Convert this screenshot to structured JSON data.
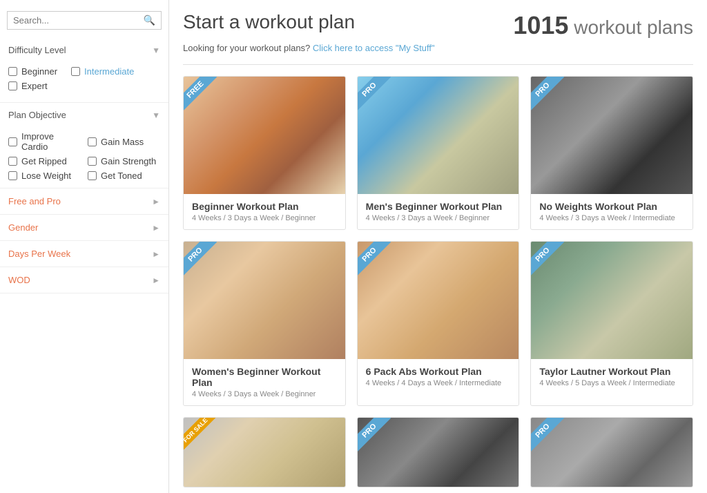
{
  "sidebar": {
    "search_placeholder": "Search...",
    "filters": {
      "difficulty": {
        "label": "Difficulty Level",
        "options": [
          {
            "label": "Beginner",
            "checked": false
          },
          {
            "label": "Intermediate",
            "checked": false,
            "highlighted": true
          },
          {
            "label": "Expert",
            "checked": false
          }
        ]
      },
      "plan_objective": {
        "label": "Plan Objective",
        "options": [
          {
            "label": "Improve Cardio",
            "checked": false
          },
          {
            "label": "Gain Mass",
            "checked": false
          },
          {
            "label": "Get Ripped",
            "checked": false
          },
          {
            "label": "Gain Strength",
            "checked": false
          },
          {
            "label": "Lose Weight",
            "checked": false
          },
          {
            "label": "Get Toned",
            "checked": false
          }
        ]
      }
    },
    "expandable_filters": [
      {
        "label": "Free and Pro"
      },
      {
        "label": "Gender"
      },
      {
        "label": "Days Per Week"
      },
      {
        "label": "WOD"
      }
    ]
  },
  "main": {
    "title": "Start a workout plan",
    "plan_count_number": "1015",
    "plan_count_label": "workout plans",
    "sub_header_text": "Looking for your workout plans?",
    "sub_header_link": "Click here to access \"My Stuff\"",
    "cards": [
      {
        "id": 1,
        "title": "Beginner Workout Plan",
        "meta": "4 Weeks / 3 Days a Week / Beginner",
        "badge": "FREE",
        "badge_type": "free",
        "img_class": "img-1"
      },
      {
        "id": 2,
        "title": "Men's Beginner Workout Plan",
        "meta": "4 Weeks / 3 Days a Week / Beginner",
        "badge": "PRO",
        "badge_type": "pro",
        "img_class": "img-2"
      },
      {
        "id": 3,
        "title": "No Weights Workout Plan",
        "meta": "4 Weeks / 3 Days a Week / Intermediate",
        "badge": "PRO",
        "badge_type": "pro",
        "img_class": "img-3"
      },
      {
        "id": 4,
        "title": "Women's Beginner Workout Plan",
        "meta": "4 Weeks / 3 Days a Week / Beginner",
        "badge": "PRO",
        "badge_type": "pro",
        "img_class": "img-4"
      },
      {
        "id": 5,
        "title": "6 Pack Abs Workout Plan",
        "meta": "4 Weeks / 4 Days a Week / Intermediate",
        "badge": "PRO",
        "badge_type": "pro",
        "img_class": "img-5"
      },
      {
        "id": 6,
        "title": "Taylor Lautner Workout Plan",
        "meta": "4 Weeks / 5 Days a Week / Intermediate",
        "badge": "PRO",
        "badge_type": "pro",
        "img_class": "img-6"
      },
      {
        "id": 7,
        "title": "",
        "meta": "",
        "badge": "FOR SALE",
        "badge_type": "sale",
        "img_class": "img-7"
      },
      {
        "id": 8,
        "title": "",
        "meta": "",
        "badge": "PRO",
        "badge_type": "pro",
        "img_class": "img-8"
      },
      {
        "id": 9,
        "title": "",
        "meta": "",
        "badge": "PRO",
        "badge_type": "pro",
        "img_class": "img-9"
      }
    ]
  }
}
